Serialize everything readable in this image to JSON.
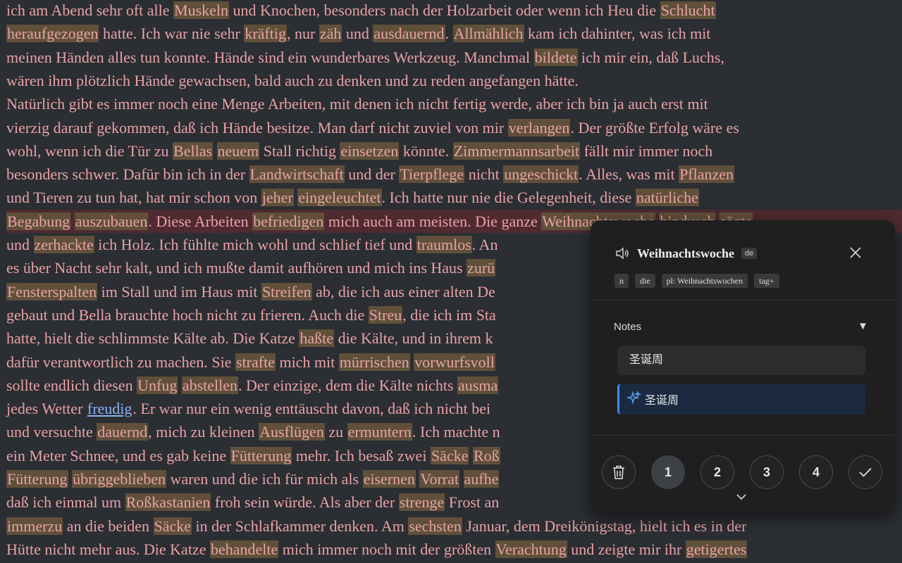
{
  "reader": {
    "lines": [
      [
        {
          "t": "ich am Abend sehr oft alle "
        },
        {
          "t": "Muskeln",
          "k": 1
        },
        {
          "t": " und Knochen, besonders nach der Holzarbeit oder wenn ich Heu die "
        },
        {
          "t": "Schlucht",
          "k": 1
        }
      ],
      [
        {
          "t": "heraufgezogen",
          "k": 1
        },
        {
          "t": " hatte. Ich war nie sehr "
        },
        {
          "t": "kräftig",
          "k": 1
        },
        {
          "t": ", nur "
        },
        {
          "t": "zäh",
          "k": 1
        },
        {
          "t": " und "
        },
        {
          "t": "ausdauernd",
          "k": 1
        },
        {
          "t": ". "
        },
        {
          "t": "Allmählich",
          "k": 1
        },
        {
          "t": " kam ich dahinter, was ich mit"
        }
      ],
      [
        {
          "t": "meinen Händen alles tun konnte. Hände sind ein wunderbares Werkzeug. Manchmal "
        },
        {
          "t": "bildete",
          "k": 1
        },
        {
          "t": " ich mir ein, daß Luchs,"
        }
      ],
      [
        {
          "t": "wären ihm plötzlich Hände gewachsen, bald auch zu denken und zu reden angefangen hätte."
        }
      ],
      [
        {
          "t": "    Natürlich gibt es immer noch eine Menge Arbeiten, mit denen ich nicht fertig werde, aber ich bin ja auch erst mit"
        }
      ],
      [
        {
          "t": "vierzig darauf gekommen, daß ich Hände besitze. Man darf nicht zuviel von mir "
        },
        {
          "t": "verlangen",
          "k": 1
        },
        {
          "t": ". Der größte Erfolg wäre es"
        }
      ],
      [
        {
          "t": "wohl, wenn ich die Tür zu "
        },
        {
          "t": "Bellas",
          "k": 1
        },
        {
          "t": " "
        },
        {
          "t": "neuem",
          "k": 1
        },
        {
          "t": " Stall richtig "
        },
        {
          "t": "einsetzen",
          "k": 1
        },
        {
          "t": " könnte. "
        },
        {
          "t": "Zimmermannsarbeit",
          "k": 1
        },
        {
          "t": " fällt mir immer noch"
        }
      ],
      [
        {
          "t": "besonders schwer. Dafür bin ich in der "
        },
        {
          "t": "Landwirtschaft",
          "k": 1
        },
        {
          "t": " und der "
        },
        {
          "t": "Tierpflege",
          "k": 1
        },
        {
          "t": " nicht "
        },
        {
          "t": "ungeschickt",
          "k": 1
        },
        {
          "t": ". Alles, was mit "
        },
        {
          "t": "Pflanzen",
          "k": 1
        }
      ],
      [
        {
          "t": "und Tieren zu tun hat, hat mir schon von "
        },
        {
          "t": "jeher",
          "k": 1
        },
        {
          "t": " "
        },
        {
          "t": "eingeleuchtet",
          "k": 1
        },
        {
          "t": ". Ich hatte nur nie die Gelegenheit, diese "
        },
        {
          "t": "natürliche",
          "k": 1
        }
      ],
      [
        {
          "t": "Begabung",
          "k": 1
        },
        {
          "t": " "
        },
        {
          "t": "auszubauen",
          "k": 1
        },
        {
          "t": ". Diese Arbeiten "
        },
        {
          "t": "befriedigen",
          "k": 1
        },
        {
          "t": " mich auch am meisten. Die ganze "
        },
        {
          "t": "Weihnachtswoche",
          "k": 1
        },
        {
          "t": " "
        },
        {
          "t": "hindurch",
          "k": 1
        },
        {
          "t": " "
        },
        {
          "t": "sägte",
          "k": 1
        }
      ],
      [
        {
          "t": "und "
        },
        {
          "t": "zerhackte",
          "k": 1
        },
        {
          "t": " ich Holz. Ich fühlte mich wohl und schlief tief und "
        },
        {
          "t": "traumlos",
          "k": 1
        },
        {
          "t": ". An"
        }
      ],
      [
        {
          "t": "es über Nacht sehr kalt, und ich mußte damit aufhören und mich ins Haus "
        },
        {
          "t": "zurü",
          "k": 1
        }
      ],
      [
        {
          "t": "Fensterspalten",
          "k": 1
        },
        {
          "t": " im Stall und im Haus mit "
        },
        {
          "t": "Streifen",
          "k": 1
        },
        {
          "t": " ab, die ich aus einer alten De"
        }
      ],
      [
        {
          "t": "gebaut und Bella brauchte hoch nicht zu frieren. Auch die "
        },
        {
          "t": "Streu",
          "k": 1
        },
        {
          "t": ", die ich im Sta"
        }
      ],
      [
        {
          "t": "hatte, hielt die schlimmste Kälte ab. Die Katze "
        },
        {
          "t": "haßte",
          "k": 1
        },
        {
          "t": " die Kälte, und in ihrem k"
        }
      ],
      [
        {
          "t": "dafür verantwortlich zu machen. Sie "
        },
        {
          "t": "strafte",
          "k": 1
        },
        {
          "t": " mich mit "
        },
        {
          "t": "mürrischen",
          "k": 1
        },
        {
          "t": " "
        },
        {
          "t": "vorwurfsvoll",
          "k": 1
        }
      ],
      [
        {
          "t": "sollte endlich diesen "
        },
        {
          "t": "Unfug",
          "k": 1
        },
        {
          "t": " "
        },
        {
          "t": "abstellen",
          "k": 1
        },
        {
          "t": ". Der einzige, dem die Kälte nichts "
        },
        {
          "t": "ausma",
          "k": 1
        }
      ],
      [
        {
          "t": "jedes Wetter "
        },
        {
          "t": "freudig",
          "l": 1
        },
        {
          "t": ". Er war nur ein wenig enttäuscht davon, daß ich nicht bei"
        }
      ],
      [
        {
          "t": "und versuchte "
        },
        {
          "t": "dauernd",
          "k": 1
        },
        {
          "t": ", mich zu kleinen "
        },
        {
          "t": "Ausflügen",
          "k": 1
        },
        {
          "t": " zu "
        },
        {
          "t": "ermuntern",
          "k": 1
        },
        {
          "t": ". Ich machte n"
        }
      ],
      [
        {
          "t": "ein Meter Schnee, und es gab keine "
        },
        {
          "t": "Fütterung",
          "k": 1
        },
        {
          "t": " mehr. Ich besaß zwei "
        },
        {
          "t": "Säcke",
          "k": 1
        },
        {
          "t": " "
        },
        {
          "t": "Roß",
          "k": 1
        }
      ],
      [
        {
          "t": "Fütterung",
          "k": 1
        },
        {
          "t": " "
        },
        {
          "t": "übriggeblieben",
          "k": 1
        },
        {
          "t": " waren und die ich für mich als "
        },
        {
          "t": "eisernen",
          "k": 1
        },
        {
          "t": " "
        },
        {
          "t": "Vorrat",
          "k": 1
        },
        {
          "t": " "
        },
        {
          "t": "aufhe",
          "k": 1
        }
      ],
      [
        {
          "t": "daß ich einmal um "
        },
        {
          "t": "Roßkastanien",
          "k": 1
        },
        {
          "t": " froh sein würde. Als aber der "
        },
        {
          "t": "strenge",
          "k": 1
        },
        {
          "t": " Frost an"
        }
      ],
      [
        {
          "t": "immerzu",
          "k": 1
        },
        {
          "t": " an die beiden "
        },
        {
          "t": "Säcke",
          "k": 1
        },
        {
          "t": " in der Schlafkammer denken. Am "
        },
        {
          "t": "sechsten",
          "k": 1
        },
        {
          "t": " Januar, dem Dreikönigstag, hielt ich es in der"
        }
      ],
      [
        {
          "t": "Hütte nicht mehr aus. Die Katze "
        },
        {
          "t": "behandelte",
          "k": 1
        },
        {
          "t": " mich immer noch mit der größten "
        },
        {
          "t": "Verachtung",
          "k": 1
        },
        {
          "t": " und zeigte mir ihr "
        },
        {
          "t": "getigertes",
          "k": 1
        }
      ]
    ],
    "highlighted_line": 9,
    "colors": {
      "text": "#e8a2a6",
      "known_bg": "#60503a",
      "highlight_line_bg": "#4f2a30",
      "background": "#2b2e33"
    }
  },
  "popup": {
    "word": "Weihnachtswoche",
    "language": "de",
    "speaker_icon": "speaker-icon",
    "tags": [
      "n",
      "die",
      "pl: Weihnachtswochen",
      "tag+"
    ],
    "notes_label": "Notes",
    "notes_toggle": "▼",
    "note_value": "圣诞周",
    "ai_suggestion": "圣诞周",
    "actions": [
      "1",
      "2",
      "3",
      "4"
    ],
    "selected_level": "1",
    "accent": "#3b8eea"
  }
}
